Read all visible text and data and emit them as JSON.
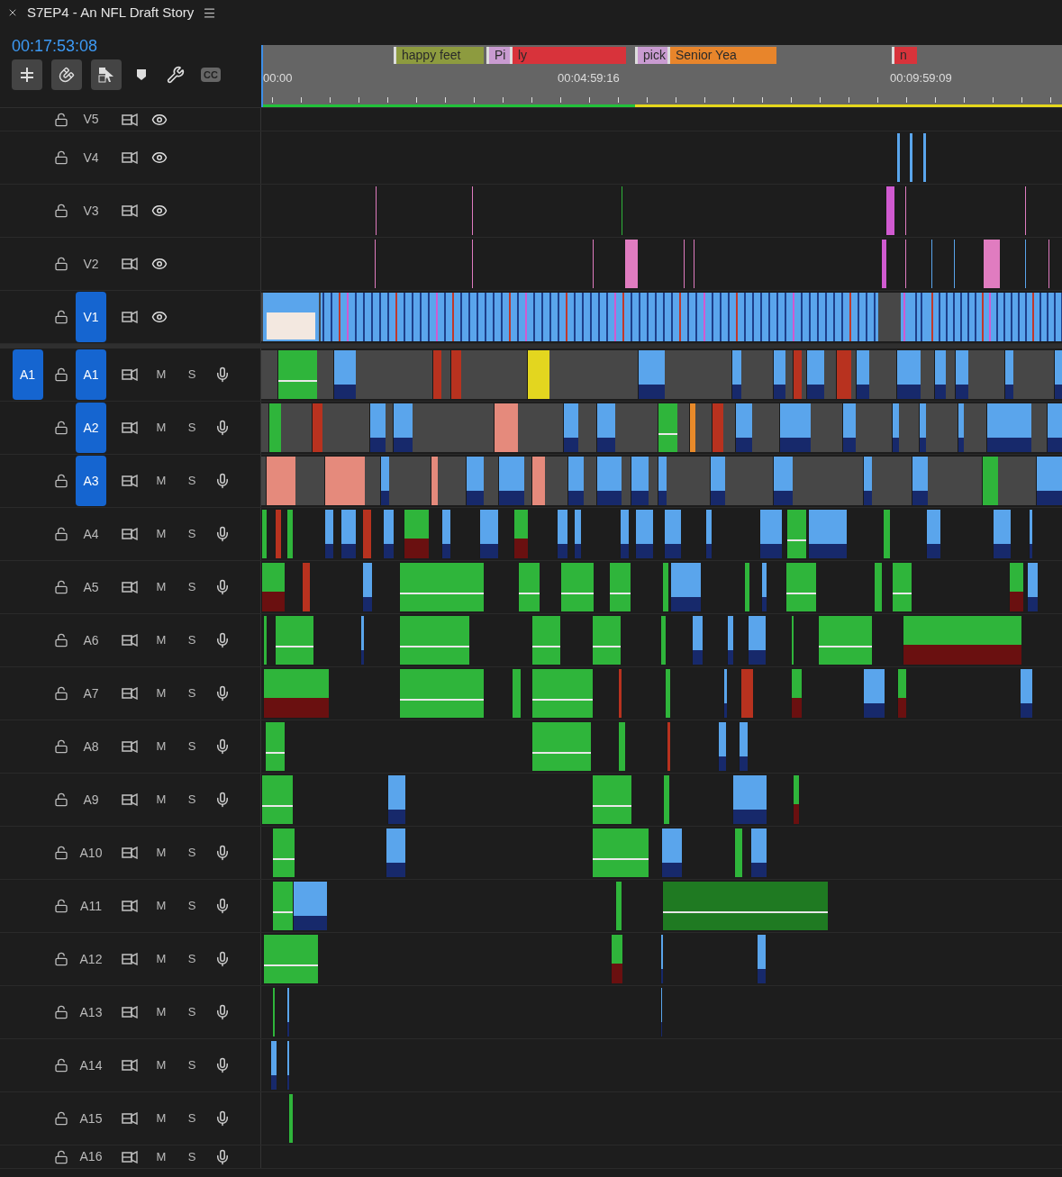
{
  "panel": {
    "title": "S7EP4 - An NFL Draft Story",
    "timecode": "00:17:53:08"
  },
  "toolbar": {
    "captions_label": "CC"
  },
  "ruler": {
    "timecodes": [
      "00:00",
      "00:04:59:16",
      "00:09:59:09"
    ],
    "markers": [
      {
        "label": "happy feet",
        "color": "#8d9b3f"
      },
      {
        "label": "Pi",
        "color": "#c99bd1"
      },
      {
        "label": "ly",
        "color": "#d8333b"
      },
      {
        "label": "pick",
        "color": "#c99bd1"
      },
      {
        "label": "Senior Yea",
        "color": "#e8852b"
      },
      {
        "label": "n",
        "color": "#d8333b"
      }
    ]
  },
  "video_tracks": [
    {
      "name": "V5",
      "targeted": false
    },
    {
      "name": "V4",
      "targeted": false
    },
    {
      "name": "V3",
      "targeted": false
    },
    {
      "name": "V2",
      "targeted": false
    },
    {
      "name": "V1",
      "targeted": true
    }
  ],
  "audio_tracks": [
    {
      "name": "A1",
      "targeted": true,
      "source_patch": "A1",
      "mute": "M",
      "solo": "S"
    },
    {
      "name": "A2",
      "targeted": true,
      "mute": "M",
      "solo": "S"
    },
    {
      "name": "A3",
      "targeted": true,
      "mute": "M",
      "solo": "S"
    },
    {
      "name": "A4",
      "targeted": false,
      "mute": "M",
      "solo": "S"
    },
    {
      "name": "A5",
      "targeted": false,
      "mute": "M",
      "solo": "S"
    },
    {
      "name": "A6",
      "targeted": false,
      "mute": "M",
      "solo": "S"
    },
    {
      "name": "A7",
      "targeted": false,
      "mute": "M",
      "solo": "S"
    },
    {
      "name": "A8",
      "targeted": false,
      "mute": "M",
      "solo": "S"
    },
    {
      "name": "A9",
      "targeted": false,
      "mute": "M",
      "solo": "S"
    },
    {
      "name": "A10",
      "targeted": false,
      "mute": "M",
      "solo": "S"
    },
    {
      "name": "A11",
      "targeted": false,
      "mute": "M",
      "solo": "S"
    },
    {
      "name": "A12",
      "targeted": false,
      "mute": "M",
      "solo": "S"
    },
    {
      "name": "A13",
      "targeted": false,
      "mute": "M",
      "solo": "S"
    },
    {
      "name": "A14",
      "targeted": false,
      "mute": "M",
      "solo": "S"
    },
    {
      "name": "A15",
      "targeted": false,
      "mute": "M",
      "solo": "S"
    },
    {
      "name": "A16",
      "targeted": false,
      "mute": "M",
      "solo": "S"
    }
  ]
}
